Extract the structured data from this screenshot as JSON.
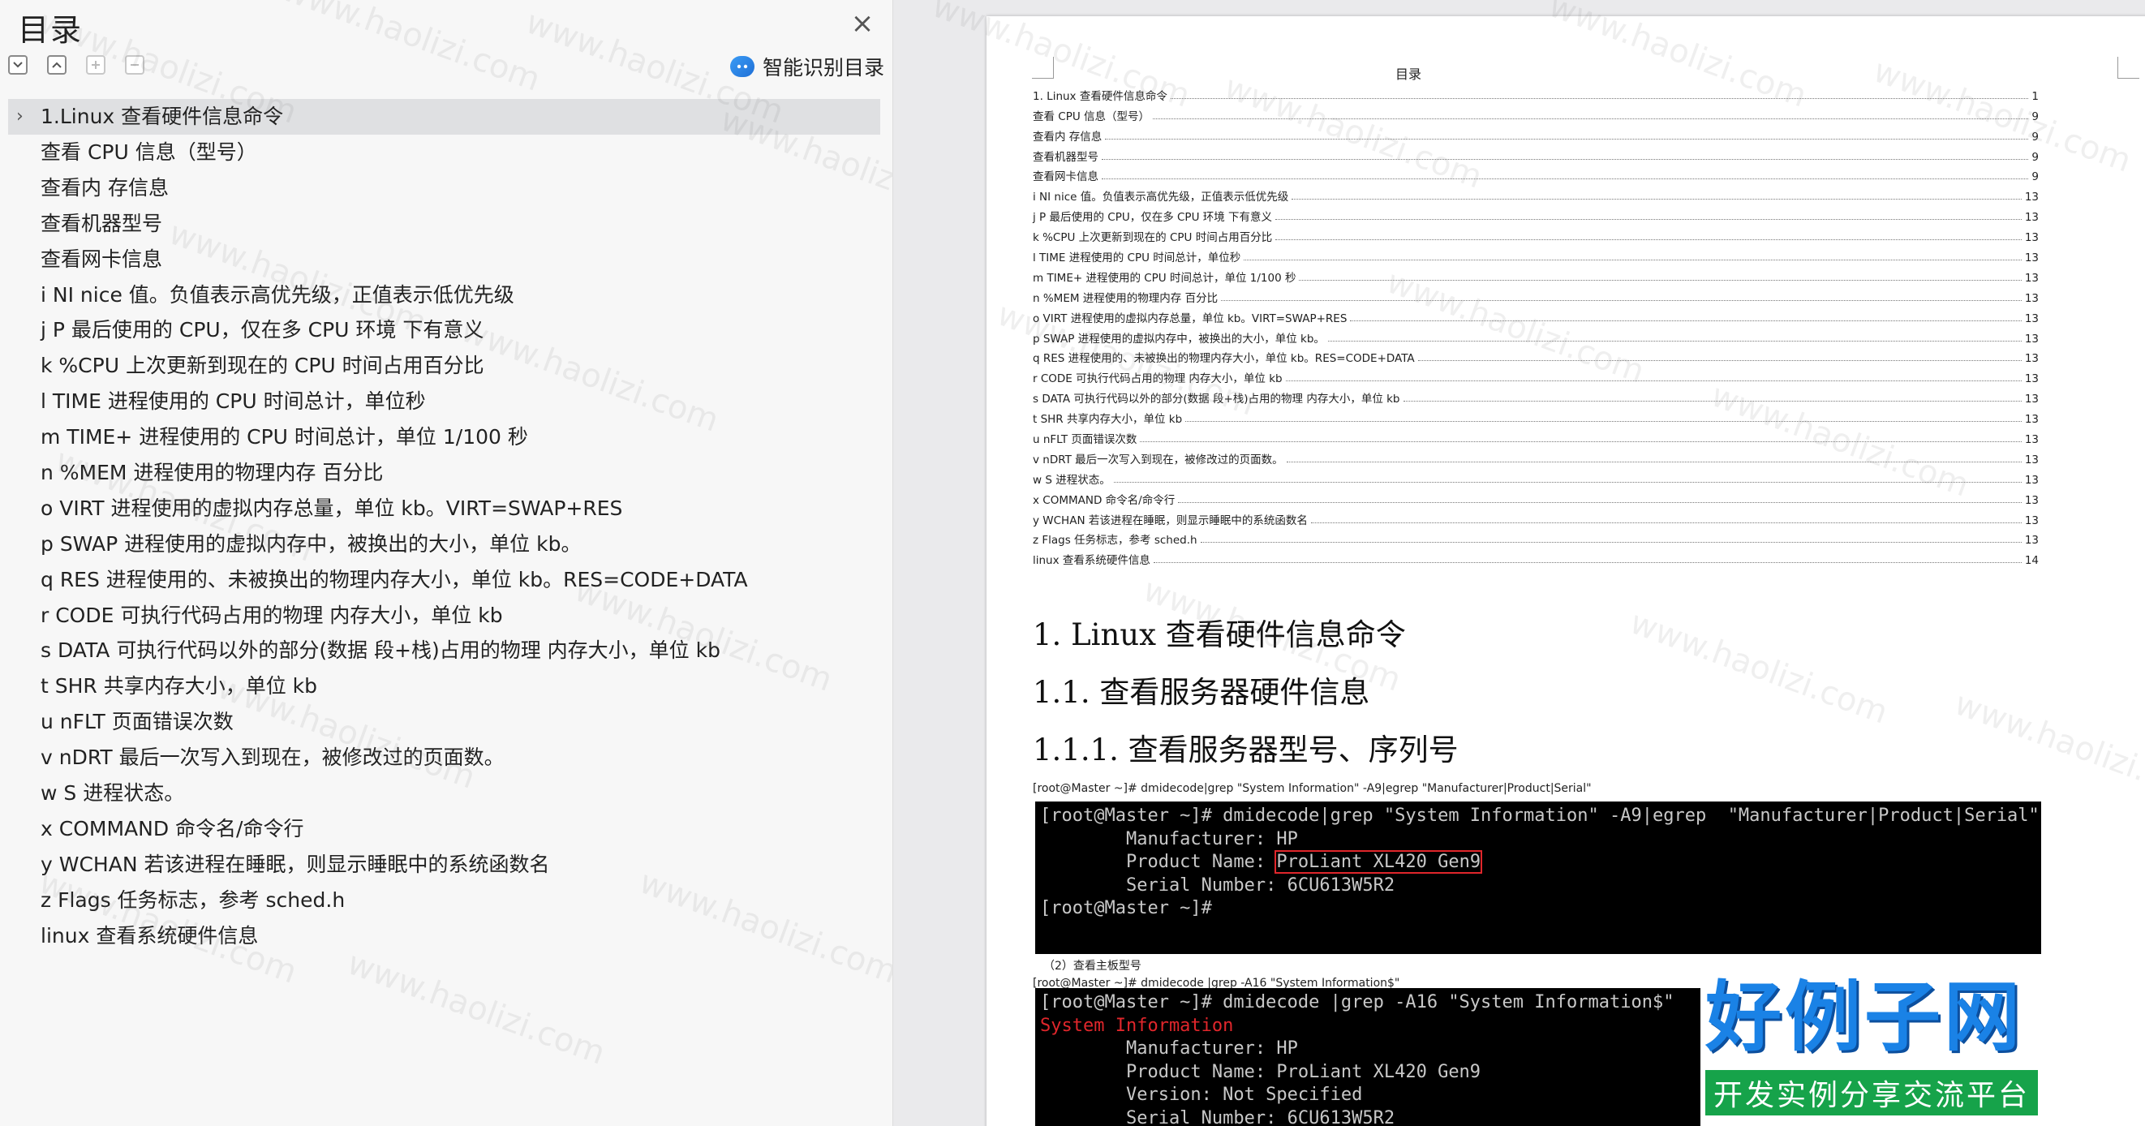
{
  "toc_panel": {
    "title": "目录",
    "smart_toc_label": "智能识别目录",
    "items": [
      "1.Linux 查看硬件信息命令",
      "查看 CPU 信息（型号）",
      "查看内  存信息",
      "查看机器型号",
      "查看网卡信息",
      "i    NI    nice 值。负值表示高优先级，正值表示低优先级",
      "j    P    最后使用的 CPU，仅在多 CPU 环境  下有意义",
      "k    %CPU    上次更新到现在的 CPU 时间占用百分比",
      "l    TIME    进程使用的 CPU 时间总计，单位秒",
      "m    TIME+    进程使用的 CPU 时间总计，单位 1/100 秒",
      "n    %MEM    进程使用的物理内存  百分比",
      "o    VIRT    进程使用的虚拟内存总量，单位 kb。VIRT=SWAP+RES",
      "p    SWAP    进程使用的虚拟内存中，被换出的大小，单位 kb。",
      "q    RES    进程使用的、未被换出的物理内存大小，单位 kb。RES=CODE+DATA",
      "r    CODE    可执行代码占用的物理  内存大小，单位 kb",
      "s    DATA    可执行代码以外的部分(数据  段+栈)占用的物理  内存大小，单位 kb",
      "t    SHR    共享内存大小，单位 kb",
      "u    nFLT    页面错误次数",
      "v    nDRT    最后一次写入到现在，被修改过的页面数。",
      "w    S    进程状态。",
      "x    COMMAND    命令名/命令行",
      "y    WCHAN    若该进程在睡眠，则显示睡眠中的系统函数名",
      "z    Flags    任务标志，参考  sched.h",
      "linux 查看系统硬件信息"
    ]
  },
  "document": {
    "toc_heading": "目录",
    "toc_entries": [
      {
        "text": "1. Linux 查看硬件信息命令",
        "page": "1"
      },
      {
        "text": "查看 CPU 信息（型号）",
        "page": "9"
      },
      {
        "text": "查看内  存信息",
        "page": "9"
      },
      {
        "text": "查看机器型号",
        "page": "9"
      },
      {
        "text": "查看网卡信息",
        "page": "9"
      },
      {
        "text": "i    NI    nice 值。负值表示高优先级，正值表示低优先级",
        "page": "13"
      },
      {
        "text": "j    P    最后使用的 CPU，仅在多 CPU 环境  下有意义",
        "page": "13"
      },
      {
        "text": "k    %CPU    上次更新到现在的 CPU 时间占用百分比",
        "page": "13"
      },
      {
        "text": "l    TIME    进程使用的 CPU 时间总计，单位秒",
        "page": "13"
      },
      {
        "text": "m    TIME+    进程使用的 CPU 时间总计，单位 1/100 秒",
        "page": "13"
      },
      {
        "text": "n    %MEM    进程使用的物理内存  百分比",
        "page": "13"
      },
      {
        "text": "o    VIRT    进程使用的虚拟内存总量，单位 kb。VIRT=SWAP+RES",
        "page": "13"
      },
      {
        "text": "p    SWAP    进程使用的虚拟内存中，被换出的大小，单位 kb。",
        "page": "13"
      },
      {
        "text": "q    RES    进程使用的、未被换出的物理内存大小，单位 kb。RES=CODE+DATA",
        "page": "13"
      },
      {
        "text": "r    CODE    可执行代码占用的物理  内存大小，单位 kb",
        "page": "13"
      },
      {
        "text": "s    DATA    可执行代码以外的部分(数据  段+栈)占用的物理  内存大小，单位 kb",
        "page": "13"
      },
      {
        "text": "t    SHR    共享内存大小，单位 kb",
        "page": "13"
      },
      {
        "text": "u    nFLT    页面错误次数",
        "page": "13"
      },
      {
        "text": "v    nDRT    最后一次写入到现在，被修改过的页面数。",
        "page": "13"
      },
      {
        "text": "w    S    进程状态。",
        "page": "13"
      },
      {
        "text": "x    COMMAND    命令名/命令行",
        "page": "13"
      },
      {
        "text": "y    WCHAN    若该进程在睡眠，则显示睡眠中的系统函数名",
        "page": "13"
      },
      {
        "text": "z    Flags    任务标志，参考  sched.h",
        "page": "13"
      },
      {
        "text": "linux 查看系统硬件信息",
        "page": "14"
      }
    ],
    "h1": "1.   Linux 查看硬件信息命令",
    "h2": "1.1.   查看服务器硬件信息",
    "h3": "1.1.1.   查看服务器型号、序列号",
    "cmd1": "[root@Master ~]# dmidecode|grep \"System Information\" -A9|egrep   \"Manufacturer|Product|Serial\"",
    "term1": {
      "line1": "[root@Master ~]# dmidecode|grep \"System Information\" -A9|egrep  \"Manufacturer|Product|Serial\"",
      "line2": "        Manufacturer: HP",
      "line3_prefix": "        Product Name: ",
      "line3_highlight": "ProLiant XL420 Gen9",
      "line4": "        Serial Number: 6CU613W5R2",
      "line5": "[root@Master ~]#"
    },
    "caption2": "（2）查看主板型号",
    "cmd2": "[root@Master ~]# dmidecode |grep -A16 \"System Information$\"",
    "term2": {
      "line1": "[root@Master ~]# dmidecode |grep -A16 \"System Information$\"",
      "line2": "System Information",
      "line3": "        Manufacturer: HP",
      "line4": "        Product Name: ProLiant XL420 Gen9",
      "line5": "        Version: Not Specified",
      "line6": "        Serial Number: 6CU613W5R2"
    }
  },
  "watermark": "www.haolizi.com",
  "brand": {
    "main": "好例子网",
    "sub": "开发实例分享交流平台"
  },
  "colors": {
    "brand_blue": "#1a82e6",
    "brand_green": "#16a34a",
    "highlight_red": "#e0262b"
  }
}
